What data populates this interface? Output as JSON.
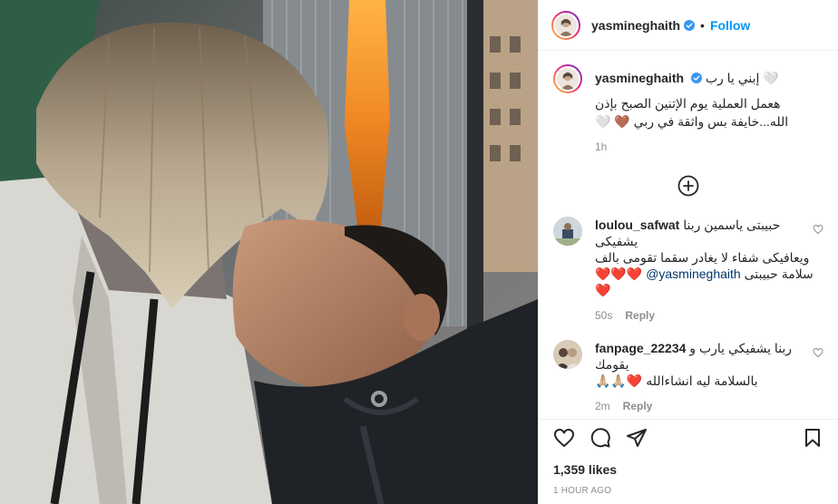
{
  "post": {
    "author": "yasmineghaith",
    "follow_label": "Follow",
    "separator": "•",
    "caption_line1": "إبني يا رب",
    "caption_line2": "هعمل العملية يوم الإتنين الصبح بإذن",
    "caption_line3": "الله...خايفة بس واثقة في ربي",
    "caption_emoji_end": "🤍",
    "caption_emoji_hands": "🤎",
    "caption_emoji_heart": "🤍",
    "caption_time": "1h",
    "likes": "1,359 likes",
    "posted": "1 HOUR AGO"
  },
  "comments": [
    {
      "user": "loulou_safwat",
      "text_line1": "حبيبتى ياسمين ربنا يشفيكى",
      "text_line2": "ويعافيكى شفاء لا يغادر سقما تقومى بالف",
      "text_line3": "سلامة حبيبتى",
      "mention": "@yasmineghaith",
      "hearts": "❤️❤️❤️",
      "heart_end": "❤️",
      "time": "50s",
      "reply": "Reply"
    },
    {
      "user": "fanpage_22234",
      "text_line1": "ربنا يشفيكي يارب و يقومك",
      "text_line2": "بالسلامة ليه انشاءالله",
      "emojis": "🙏🏼🙏🏼❤️",
      "time": "2m",
      "reply": "Reply"
    }
  ],
  "icons": {
    "verified": "verified-badge-icon",
    "heart": "heart-icon",
    "comment": "comment-icon",
    "share": "share-icon",
    "save": "bookmark-icon",
    "load_more": "plus-circle-icon"
  },
  "colors": {
    "accent": "#0095f6",
    "text": "#262626",
    "muted": "#8e8e8e",
    "heart_red": "#ed4956",
    "border": "#efefef"
  }
}
